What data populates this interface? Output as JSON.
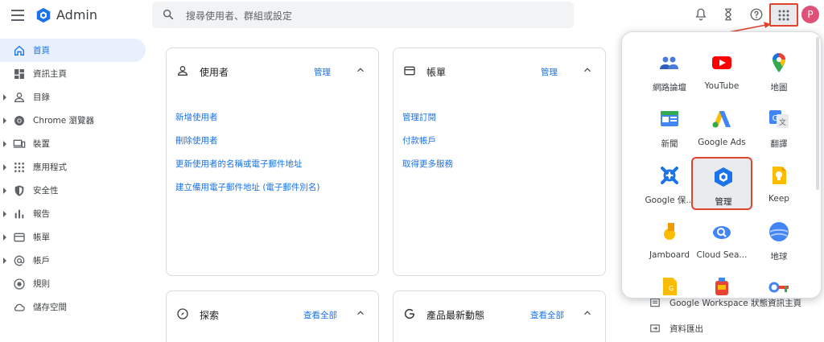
{
  "header": {
    "app_title": "Admin",
    "search_placeholder": "搜尋使用者、群組或設定",
    "avatar_letter": "P"
  },
  "sidebar": {
    "items": [
      {
        "label": "首頁",
        "icon": "home-icon",
        "active": true,
        "expandable": false
      },
      {
        "label": "資訊主頁",
        "icon": "dashboard-icon",
        "active": false,
        "expandable": false
      },
      {
        "label": "目錄",
        "icon": "person-icon",
        "active": false,
        "expandable": true
      },
      {
        "label": "Chrome 瀏覽器",
        "icon": "chrome-icon",
        "active": false,
        "expandable": true
      },
      {
        "label": "裝置",
        "icon": "devices-icon",
        "active": false,
        "expandable": true
      },
      {
        "label": "應用程式",
        "icon": "apps-grid-icon",
        "active": false,
        "expandable": true
      },
      {
        "label": "安全性",
        "icon": "shield-icon",
        "active": false,
        "expandable": true
      },
      {
        "label": "報告",
        "icon": "bar-chart-icon",
        "active": false,
        "expandable": true
      },
      {
        "label": "帳單",
        "icon": "credit-card-icon",
        "active": false,
        "expandable": true
      },
      {
        "label": "帳戶",
        "icon": "at-sign-icon",
        "active": false,
        "expandable": true
      },
      {
        "label": "規則",
        "icon": "rules-icon",
        "active": false,
        "expandable": false
      },
      {
        "label": "儲存空間",
        "icon": "cloud-icon",
        "active": false,
        "expandable": false
      }
    ]
  },
  "cards": {
    "users": {
      "title": "使用者",
      "action": "管理",
      "links": [
        "新增使用者",
        "刪除使用者",
        "更新使用者的名稱或電子郵件地址",
        "建立備用電子郵件地址 (電子郵件別名)"
      ]
    },
    "billing": {
      "title": "帳單",
      "action": "管理",
      "links": [
        "管理訂閱",
        "付款帳戶",
        "取得更多服務"
      ]
    },
    "explore": {
      "title": "探索",
      "action": "查看全部"
    },
    "updates": {
      "title": "產品最新動態",
      "action": "查看全部"
    }
  },
  "side_list": {
    "status_dashboard": "Google Workspace 狀態資訊主頁",
    "data_export": "資料匯出"
  },
  "launcher": {
    "apps": [
      {
        "label": "網路論壇",
        "icon": "groups-icon"
      },
      {
        "label": "YouTube",
        "icon": "youtube-icon"
      },
      {
        "label": "地圖",
        "icon": "maps-pin-icon"
      },
      {
        "label": "新聞",
        "icon": "news-icon"
      },
      {
        "label": "Google Ads",
        "icon": "google-ads-icon"
      },
      {
        "label": "翻譯",
        "icon": "translate-icon"
      },
      {
        "label": "Google 保...",
        "icon": "vault-icon"
      },
      {
        "label": "管理",
        "icon": "admin-hexagon-icon",
        "selected": true
      },
      {
        "label": "Keep",
        "icon": "keep-bulb-icon"
      },
      {
        "label": "Jamboard",
        "icon": "jamboard-icon"
      },
      {
        "label": "Cloud Sea...",
        "icon": "cloud-search-icon"
      },
      {
        "label": "地球",
        "icon": "earth-icon"
      }
    ]
  },
  "colors": {
    "accent": "#1a73e8",
    "highlight": "#e0442e",
    "avatar": "#e0517a"
  }
}
